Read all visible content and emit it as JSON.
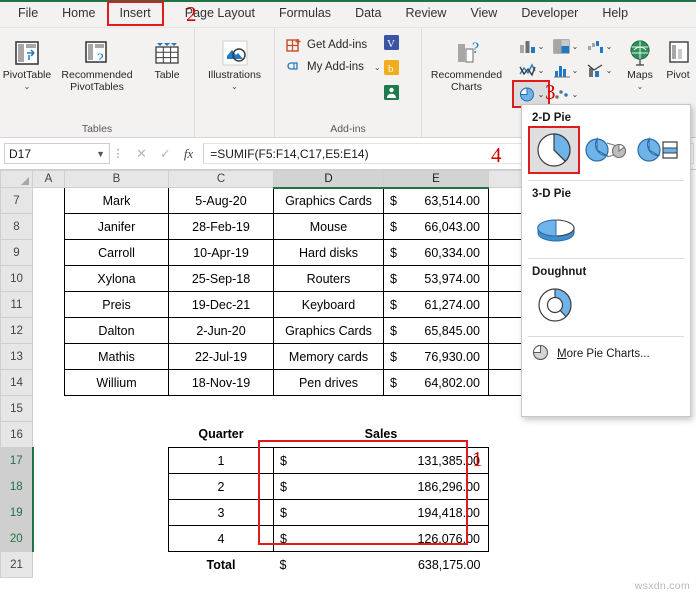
{
  "ribbon_tabs": [
    {
      "label": "File",
      "marked": false
    },
    {
      "label": "Home",
      "marked": false
    },
    {
      "label": "Insert",
      "marked": true
    },
    {
      "label": "Page Layout",
      "marked": false
    },
    {
      "label": "Formulas",
      "marked": false
    },
    {
      "label": "Data",
      "marked": false
    },
    {
      "label": "Review",
      "marked": false
    },
    {
      "label": "View",
      "marked": false
    },
    {
      "label": "Developer",
      "marked": false
    },
    {
      "label": "Help",
      "marked": false
    }
  ],
  "ribbon": {
    "groups": [
      {
        "name": "Tables",
        "label": "Tables",
        "buttons": [
          {
            "label": "PivotTable",
            "icon": "pivottable-icon",
            "caret": true
          },
          {
            "label": "Recommended PivotTables",
            "icon": "recommended-pivottables-icon",
            "caret": false
          },
          {
            "label": "Table",
            "icon": "table-icon",
            "caret": false
          }
        ]
      },
      {
        "name": "Illustrations",
        "label": "",
        "buttons": [
          {
            "label": "Illustrations",
            "icon": "illustrations-icon",
            "caret": true
          }
        ]
      },
      {
        "name": "Add-ins",
        "label": "Add-ins",
        "items": [
          {
            "label": "Get Add-ins",
            "icon": "get-addins-icon"
          },
          {
            "label": "My Add-ins",
            "icon": "my-addins-icon",
            "caret": true
          }
        ]
      },
      {
        "name": "Charts",
        "label": "",
        "buttons": [
          {
            "label": "Recommended Charts",
            "icon": "recommended-charts-icon",
            "caret": false
          }
        ]
      },
      {
        "name": "Tours",
        "label": "",
        "buttons": [
          {
            "label": "Maps",
            "icon": "maps-icon",
            "caret": true
          },
          {
            "label": "Pivot",
            "icon": "pivotchart-icon",
            "caret": false
          }
        ]
      }
    ],
    "chart_buttons": [
      {
        "name": "column-chart-button"
      },
      {
        "name": "hierarchy-chart-button"
      },
      {
        "name": "waterfall-chart-button"
      },
      {
        "name": "line-chart-button"
      },
      {
        "name": "statistic-chart-button"
      },
      {
        "name": "combo-chart-button"
      },
      {
        "name": "pie-chart-button"
      },
      {
        "name": "scatter-chart-button"
      }
    ]
  },
  "annotations": [
    {
      "number": "1",
      "target": "sales-range"
    },
    {
      "number": "2",
      "target": "insert-tab"
    },
    {
      "number": "3",
      "target": "pie-chart-button"
    },
    {
      "number": "4",
      "target": "formula-bar"
    }
  ],
  "formula_bar": {
    "name_box": "D17",
    "cancel_icon": "✕",
    "confirm_icon": "✓",
    "fx_label": "fx",
    "formula": "=SUMIF(F5:F14,C17,E5:E14)"
  },
  "sheet": {
    "columns": [
      "A",
      "B",
      "C",
      "D",
      "E"
    ],
    "selected_columns": [
      "D",
      "E"
    ],
    "row_numbers": [
      "7",
      "8",
      "9",
      "10",
      "11",
      "12",
      "13",
      "14",
      "15",
      "16",
      "17",
      "18",
      "19",
      "20",
      "21"
    ],
    "selected_rows": [
      "17",
      "18",
      "19",
      "20"
    ],
    "data_rows": [
      {
        "row": "7",
        "name": "Mark",
        "date": "5-Aug-20",
        "product": "Graphics Cards",
        "currency": "$",
        "amount": "63,514.00"
      },
      {
        "row": "8",
        "name": "Janifer",
        "date": "28-Feb-19",
        "product": "Mouse",
        "currency": "$",
        "amount": "66,043.00"
      },
      {
        "row": "9",
        "name": "Carroll",
        "date": "10-Apr-19",
        "product": "Hard disks",
        "currency": "$",
        "amount": "60,334.00"
      },
      {
        "row": "10",
        "name": "Xylona",
        "date": "25-Sep-18",
        "product": "Routers",
        "currency": "$",
        "amount": "53,974.00"
      },
      {
        "row": "11",
        "name": "Preis",
        "date": "19-Dec-21",
        "product": "Keyboard",
        "currency": "$",
        "amount": "61,274.00"
      },
      {
        "row": "12",
        "name": "Dalton",
        "date": "2-Jun-20",
        "product": "Graphics Cards",
        "currency": "$",
        "amount": "65,845.00"
      },
      {
        "row": "13",
        "name": "Mathis",
        "date": "22-Jul-19",
        "product": "Memory cards",
        "currency": "$",
        "amount": "76,930.00"
      },
      {
        "row": "14",
        "name": "Willium",
        "date": "18-Nov-19",
        "product": "Pen drives",
        "currency": "$",
        "amount": "64,802.00"
      }
    ],
    "summary_table": {
      "headers": {
        "quarter": "Quarter",
        "sales": "Sales"
      },
      "rows": [
        {
          "row": "17",
          "quarter": "1",
          "currency": "$",
          "amount": "131,385.00",
          "shaded": false
        },
        {
          "row": "18",
          "quarter": "2",
          "currency": "$",
          "amount": "186,296.00",
          "shaded": true
        },
        {
          "row": "19",
          "quarter": "3",
          "currency": "$",
          "amount": "194,418.00",
          "shaded": true
        },
        {
          "row": "20",
          "quarter": "4",
          "currency": "$",
          "amount": "126,076.00",
          "shaded": true
        }
      ],
      "total": {
        "row": "21",
        "label": "Total",
        "currency": "$",
        "amount": "638,175.00"
      }
    }
  },
  "dropdown": {
    "sections": [
      {
        "title": "2-D Pie",
        "items": [
          {
            "name": "pie-2d-option",
            "selected": true
          },
          {
            "name": "pie-of-pie-option",
            "selected": false
          },
          {
            "name": "bar-of-pie-option",
            "selected": false
          }
        ]
      },
      {
        "title": "3-D Pie",
        "items": [
          {
            "name": "pie-3d-option",
            "selected": false
          }
        ]
      },
      {
        "title": "Doughnut",
        "items": [
          {
            "name": "doughnut-option",
            "selected": false
          }
        ]
      }
    ],
    "more_label_prefix": "M",
    "more_label": "ore Pie Charts..."
  },
  "watermark": "wsxdn.com",
  "colors": {
    "header_green": "#22a347",
    "total_yellow": "#fce4a4",
    "total_blue": "#b9cde5",
    "annotation_red": "#d00000",
    "excel_green": "#217346"
  }
}
